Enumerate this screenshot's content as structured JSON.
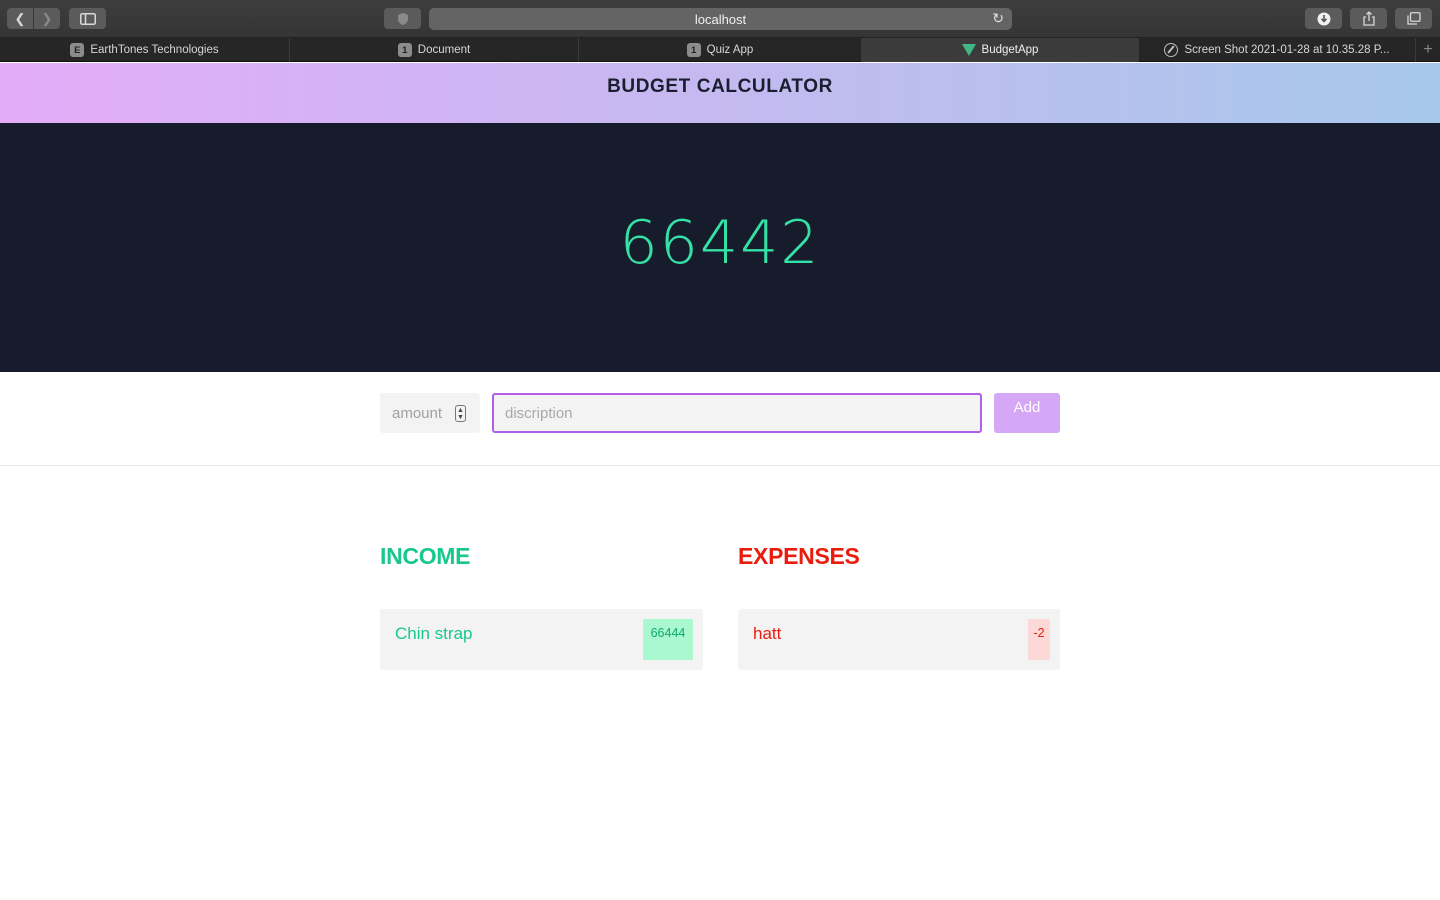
{
  "browser": {
    "url": "localhost",
    "tabs": [
      {
        "badge": "E",
        "label": "EarthTones Technologies"
      },
      {
        "badge": "1",
        "label": "Document"
      },
      {
        "badge": "1",
        "label": "Quiz App"
      },
      {
        "badge": "",
        "label": "BudgetApp"
      },
      {
        "badge": "",
        "label": "Screen Shot 2021-01-28 at 10.35.28 P..."
      }
    ],
    "active_tab": "BudgetApp"
  },
  "app": {
    "title": "BUDGET CALCULATOR",
    "total": "66442"
  },
  "form": {
    "amount_placeholder": "amount",
    "description_placeholder": "discription",
    "add_label": "Add"
  },
  "income": {
    "title": "INCOME",
    "items": [
      {
        "description": "Chin strap",
        "value": "66444"
      }
    ]
  },
  "expenses": {
    "title": "EXPENSES",
    "items": [
      {
        "description": "hatt",
        "value": "-2"
      }
    ]
  },
  "colors": {
    "income": "#17c98a",
    "expense": "#ea1c0d",
    "hero_bg": "#161c2c",
    "accent": "#b45ee6"
  }
}
